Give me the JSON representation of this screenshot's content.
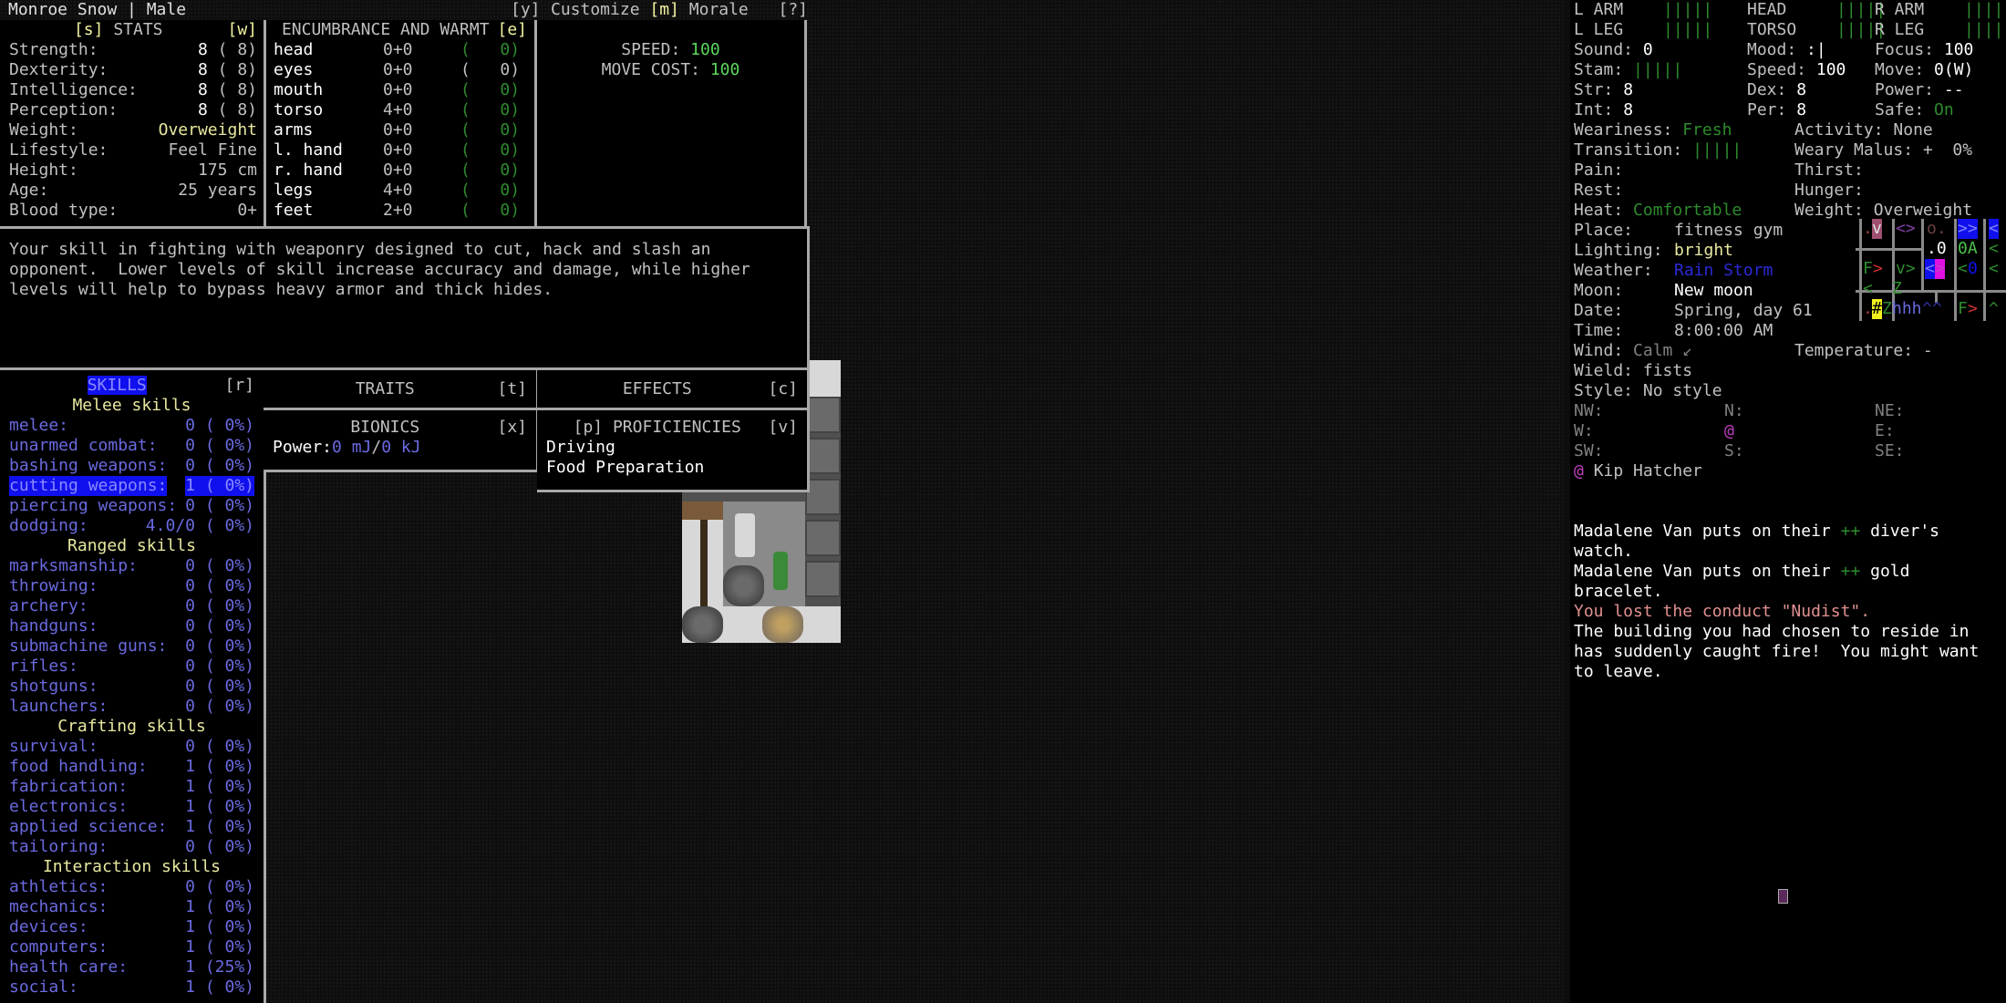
{
  "header": {
    "title": "Monroe Snow | Male"
  },
  "stats": {
    "key": "[s]",
    "title": "STATS",
    "right_key": "[w]",
    "rows": [
      {
        "label": "Strength:",
        "value": "8",
        "base": "( 8)"
      },
      {
        "label": "Dexterity:",
        "value": "8",
        "base": "( 8)"
      },
      {
        "label": "Intelligence:",
        "value": "8",
        "base": "( 8)"
      },
      {
        "label": "Perception:",
        "value": "8",
        "base": "( 8)"
      },
      {
        "label": "Weight:",
        "value": "Overweight"
      },
      {
        "label": "Lifestyle:",
        "value": "Feel Fine"
      },
      {
        "label": "Height:",
        "value": "175 cm"
      },
      {
        "label": "Age:",
        "value": "25 years"
      },
      {
        "label": "Blood type:",
        "value": "0+"
      }
    ]
  },
  "encumbrance": {
    "title": "ENCUMBRANCE AND WARMT",
    "key": "[e]",
    "top_key": "[y]",
    "rows": [
      {
        "part": "head",
        "enc": "0+0",
        "warmth": "0"
      },
      {
        "part": "eyes",
        "enc": "0+0",
        "warmth": "0"
      },
      {
        "part": "mouth",
        "enc": "0+0",
        "warmth": "0"
      },
      {
        "part": "torso",
        "enc": "4+0",
        "warmth": "0"
      },
      {
        "part": "arms",
        "enc": "0+0",
        "warmth": "0"
      },
      {
        "part": "l. hand",
        "enc": "0+0",
        "warmth": "0"
      },
      {
        "part": "r. hand",
        "enc": "0+0",
        "warmth": "0"
      },
      {
        "part": "legs",
        "enc": "4+0",
        "warmth": "0"
      },
      {
        "part": "feet",
        "enc": "2+0",
        "warmth": "0"
      }
    ]
  },
  "speed": {
    "customize_label": "Customize",
    "morale_key": "[m]",
    "morale_label": "Morale",
    "help_key": "[?]",
    "speed_label": "SPEED:",
    "speed_value": "100",
    "move_cost_label": "MOVE COST:",
    "move_cost_value": "100"
  },
  "description": {
    "lines": [
      "Your skill in fighting with weaponry designed to cut, hack and slash an",
      "opponent.  Lower levels of skill increase accuracy and damage, while higher",
      "levels will help to bypass heavy armor and thick hides."
    ]
  },
  "skills": {
    "title": "SKILLS",
    "key": "[r]",
    "groups": [
      {
        "name": "Melee skills",
        "items": [
          {
            "label": "melee:",
            "level": "0",
            "pct": "( 0%)"
          },
          {
            "label": "unarmed combat:",
            "level": "0",
            "pct": "( 0%)"
          },
          {
            "label": "bashing weapons:",
            "level": "0",
            "pct": "( 0%)"
          },
          {
            "label": "cutting weapons:",
            "level": "1",
            "pct": "( 0%)",
            "selected": true
          },
          {
            "label": "piercing weapons:",
            "level": "0",
            "pct": "( 0%)"
          },
          {
            "label": "dodging:",
            "level": "4.0/0",
            "pct": "( 0%)"
          }
        ]
      },
      {
        "name": "Ranged skills",
        "items": [
          {
            "label": "marksmanship:",
            "level": "0",
            "pct": "( 0%)"
          },
          {
            "label": "throwing:",
            "level": "0",
            "pct": "( 0%)"
          },
          {
            "label": "archery:",
            "level": "0",
            "pct": "( 0%)"
          },
          {
            "label": "handguns:",
            "level": "0",
            "pct": "( 0%)"
          },
          {
            "label": "submachine guns:",
            "level": "0",
            "pct": "( 0%)"
          },
          {
            "label": "rifles:",
            "level": "0",
            "pct": "( 0%)"
          },
          {
            "label": "shotguns:",
            "level": "0",
            "pct": "( 0%)"
          },
          {
            "label": "launchers:",
            "level": "0",
            "pct": "( 0%)"
          }
        ]
      },
      {
        "name": "Crafting skills",
        "items": [
          {
            "label": "survival:",
            "level": "0",
            "pct": "( 0%)"
          },
          {
            "label": "food handling:",
            "level": "1",
            "pct": "( 0%)"
          },
          {
            "label": "fabrication:",
            "level": "1",
            "pct": "( 0%)"
          },
          {
            "label": "electronics:",
            "level": "1",
            "pct": "( 0%)"
          },
          {
            "label": "applied science:",
            "level": "1",
            "pct": "( 0%)"
          },
          {
            "label": "tailoring:",
            "level": "0",
            "pct": "( 0%)"
          }
        ]
      },
      {
        "name": "Interaction skills",
        "items": [
          {
            "label": "athletics:",
            "level": "0",
            "pct": "( 0%)"
          },
          {
            "label": "mechanics:",
            "level": "1",
            "pct": "( 0%)"
          },
          {
            "label": "devices:",
            "level": "1",
            "pct": "( 0%)"
          },
          {
            "label": "computers:",
            "level": "1",
            "pct": "( 0%)"
          },
          {
            "label": "health care:",
            "level": "1",
            "pct": "(25%)"
          },
          {
            "label": "social:",
            "level": "1",
            "pct": "( 0%)"
          }
        ]
      }
    ]
  },
  "traits": {
    "title": "TRAITS",
    "key": "[t]"
  },
  "effects": {
    "title": "EFFECTS",
    "key": "[c]"
  },
  "bionics": {
    "title": "BIONICS",
    "key": "[x]",
    "power_label": "Power:",
    "power_current": "0 mJ",
    "separator": "/",
    "power_max": "0 kJ"
  },
  "proficiencies": {
    "left_key": "[p]",
    "title": "PROFICIENCIES",
    "key": "[v]",
    "items": [
      "Driving",
      "Food Preparation"
    ]
  },
  "sidebar": {
    "body": [
      {
        "label": "L ARM",
        "bar": "|||||"
      },
      {
        "label": "HEAD",
        "bar": "|||||"
      },
      {
        "label": "R ARM",
        "bar": "|||||"
      },
      {
        "label": "L LEG",
        "bar": "|||||"
      },
      {
        "label": "TORSO",
        "bar": "|||||"
      },
      {
        "label": "R LEG",
        "bar": "|||||"
      }
    ],
    "sound_label": "Sound:",
    "sound": "0",
    "mood_label": "Mood:",
    "mood": ":|",
    "focus_label": "Focus:",
    "focus": "100",
    "stam_label": "Stam:",
    "stam": "|||||",
    "speed_label": "Speed:",
    "speed": "100",
    "move_label": "Move:",
    "move": "0(W)",
    "str_label": "Str:",
    "str": "8",
    "dex_label": "Dex:",
    "dex": "8",
    "power_label": "Power:",
    "power": "--",
    "int_label": "Int:",
    "int": "8",
    "per_label": "Per:",
    "per": "8",
    "safe_label": "Safe:",
    "safe": "On",
    "weariness_label": "Weariness:",
    "weariness": "Fresh",
    "activity_label": "Activity:",
    "activity": "None",
    "transition_label": "Transition:",
    "transition": "|||||",
    "weary_malus_label": "Weary Malus:",
    "weary_malus": "+  0%",
    "pain_label": "Pain:",
    "thirst_label": "Thirst:",
    "rest_label": "Rest:",
    "hunger_label": "Hunger:",
    "heat_label": "Heat:",
    "heat": "Comfortable",
    "weight_label": "Weight:",
    "weight": "Overweight",
    "place_label": "Place:",
    "place": "fitness gym",
    "lighting_label": "Lighting:",
    "lighting": "bright",
    "weather_label": "Weather:",
    "weather": "Rain Storm",
    "moon_label": "Moon:",
    "moon": "New moon",
    "date_label": "Date:",
    "date": "Spring, day 61",
    "time_label": "Time:",
    "time": "8:00:00 AM",
    "wind_label": "Wind:",
    "wind": "Calm ↙",
    "temperature_label": "Temperature:",
    "temperature": "-",
    "wield_label": "Wield:",
    "wield": "fists",
    "style_label": "Style:",
    "style": "No style",
    "compass": {
      "nw": "NW:",
      "n": "N:",
      "ne": "NE:",
      "w": "W:",
      "center": "@",
      "e": "E:",
      "sw": "SW:",
      "s": "S:",
      "se": "SE:"
    },
    "npc_symbol": "@",
    "npc_name": "Kip Hatcher",
    "minimap": {
      "r1": [
        ".",
        "v",
        "<>",
        "o.",
        ">>",
        "<"
      ],
      "r2": [
        ".0",
        "0A",
        "<"
      ],
      "r3": [
        "F",
        ">",
        "v>",
        "<",
        ">",
        "<",
        "0",
        "<"
      ],
      "r4": [
        "<",
        "Z"
      ],
      "r5": [
        ".",
        "#",
        "Z",
        "hhh",
        "^^",
        "F",
        ">",
        "^"
      ]
    },
    "messages": [
      {
        "parts": [
          {
            "t": "Madalene Van puts on their ",
            "c": "white"
          },
          {
            "t": "++",
            "c": "green"
          },
          {
            "t": " diver's",
            "c": "white"
          }
        ]
      },
      {
        "parts": [
          {
            "t": "watch.",
            "c": "white"
          }
        ]
      },
      {
        "parts": [
          {
            "t": "Madalene Van puts on their ",
            "c": "white"
          },
          {
            "t": "++",
            "c": "green"
          },
          {
            "t": " gold",
            "c": "white"
          }
        ]
      },
      {
        "parts": [
          {
            "t": "bracelet.",
            "c": "white"
          }
        ]
      },
      {
        "parts": [
          {
            "t": "You lost the conduct \"Nudist\".",
            "c": "pink"
          }
        ]
      },
      {
        "parts": [
          {
            "t": "The building you had chosen to reside in",
            "c": "white"
          }
        ]
      },
      {
        "parts": [
          {
            "t": "has suddenly caught fire!  You might want",
            "c": "white"
          }
        ]
      },
      {
        "parts": [
          {
            "t": "to leave.",
            "c": "white"
          }
        ]
      }
    ]
  },
  "colors": {
    "selection": "#1010ee",
    "skill_text": "#6a6ae0",
    "ok_green": "#2e8b2e",
    "header_yellow": "#f2f2a0"
  }
}
